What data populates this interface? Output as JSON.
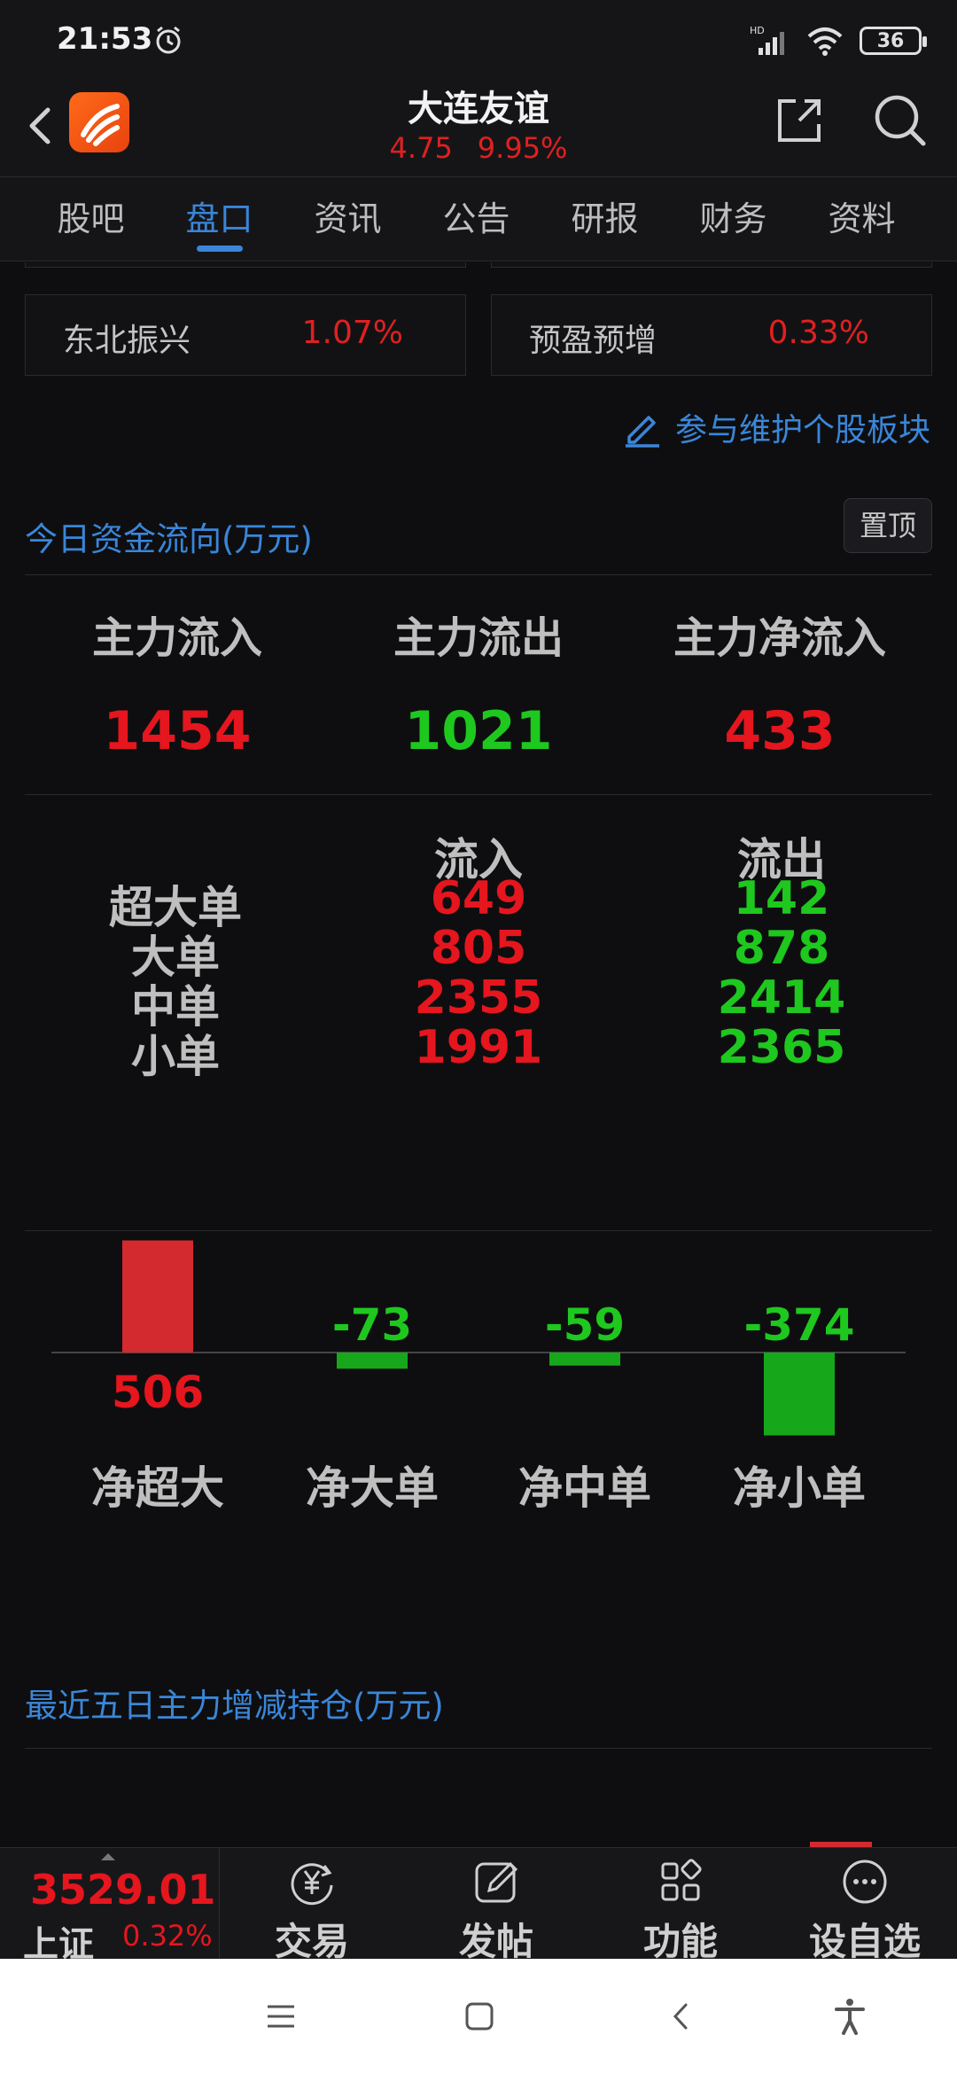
{
  "status": {
    "time": "21:53",
    "network": "HD",
    "battery": "36"
  },
  "header": {
    "title": "大连友谊",
    "price": "4.75",
    "change_pct": "9.95%"
  },
  "tabs": [
    {
      "label": "股吧"
    },
    {
      "label": "盘口"
    },
    {
      "label": "资讯"
    },
    {
      "label": "公告"
    },
    {
      "label": "研报"
    },
    {
      "label": "财务"
    },
    {
      "label": "资料"
    }
  ],
  "sectors": [
    {
      "name": "东北振兴",
      "value": "1.07%"
    },
    {
      "name": "预盈预增",
      "value": "0.33%"
    }
  ],
  "maintain_link": "参与维护个股板块",
  "fund_flow": {
    "title": "今日资金流向(万元)",
    "pin_label": "置顶",
    "main": [
      {
        "label": "主力流入",
        "value": "1454"
      },
      {
        "label": "主力流出",
        "value": "1021"
      },
      {
        "label": "主力净流入",
        "value": "433"
      }
    ],
    "table": {
      "inflow_header": "流入",
      "outflow_header": "流出",
      "rows": [
        {
          "label": "超大单",
          "inflow": "649",
          "outflow": "142"
        },
        {
          "label": "大单",
          "inflow": "805",
          "outflow": "878"
        },
        {
          "label": "中单",
          "inflow": "2355",
          "outflow": "2414"
        },
        {
          "label": "小单",
          "inflow": "1991",
          "outflow": "2365"
        }
      ]
    }
  },
  "chart_data": {
    "type": "bar",
    "categories": [
      "净超大",
      "净大单",
      "净中单",
      "净小单"
    ],
    "values": [
      506,
      -73,
      -59,
      -374
    ],
    "positive_color": "#d22a2f",
    "negative_color": "#16a81a"
  },
  "five_day": {
    "title": "最近五日主力增减持仓(万元)"
  },
  "bottom_bar": {
    "index_value": "3529.01",
    "index_name": "上证",
    "index_change": "0.32%",
    "nav": [
      {
        "label": "交易",
        "icon": "yen-refresh-icon"
      },
      {
        "label": "发帖",
        "icon": "compose-icon"
      },
      {
        "label": "功能",
        "icon": "grid-icon"
      },
      {
        "label": "设自选",
        "icon": "more-circle-icon"
      }
    ]
  }
}
